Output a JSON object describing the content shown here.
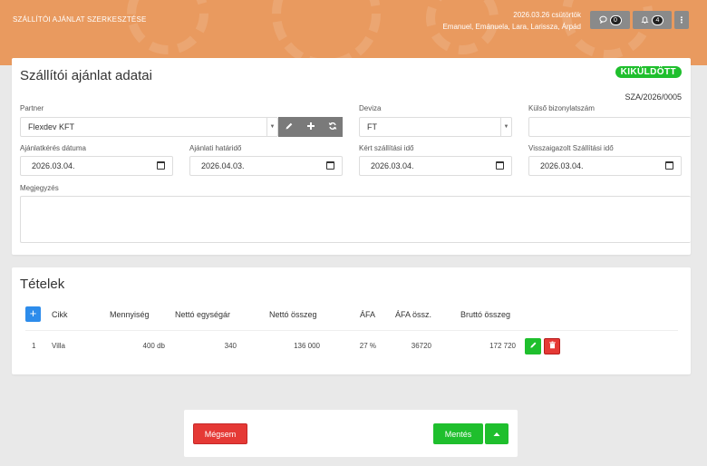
{
  "header": {
    "title": "SZÁLLÍTÓI AJÁNLAT SZERKESZTÉSE",
    "date": "2026.03.26 csütörtök",
    "users": "Emanuel, Emánuela, Lara, Larissza, Árpád",
    "messages_count": "0",
    "notifications_count": "4",
    "menu_glyph": "⋮"
  },
  "offer": {
    "title": "Szállítói ajánlat adatai",
    "status": "KIKÜLDÖTT",
    "status_color": "#1fbf2d",
    "doc_number": "SZA/2026/0005",
    "partner": {
      "label": "Partner",
      "value": "Flexdev KFT"
    },
    "currency": {
      "label": "Deviza",
      "value": "FT"
    },
    "external_doc": {
      "label": "Külső bizonylatszám",
      "value": ""
    },
    "request_date": {
      "label": "Ajánlatkérés dátuma",
      "value": "2026.03.04."
    },
    "deadline": {
      "label": "Ajánlati határidő",
      "value": "2026.04.03."
    },
    "requested_delivery": {
      "label": "Kért szállítási idő",
      "value": "2026.03.04."
    },
    "confirmed_delivery": {
      "label": "Visszaigazolt Szállítási idő",
      "value": "2026.03.04."
    },
    "note": {
      "label": "Megjegyzés",
      "value": ""
    }
  },
  "items": {
    "title": "Tételek",
    "columns": {
      "item": "Cikk",
      "quantity": "Mennyiség",
      "net_unit": "Nettó egységár",
      "net_total": "Nettó összeg",
      "vat": "ÁFA",
      "vat_amount": "ÁFA össz.",
      "gross_total": "Bruttó összeg"
    },
    "rows": [
      {
        "index": "1",
        "item": "Villa",
        "quantity": "400 db",
        "net_unit": "340",
        "net_total": "136 000",
        "vat": "27 %",
        "vat_amount": "36720",
        "gross_total": "172 720"
      }
    ]
  },
  "footer": {
    "cancel_label": "Mégsem",
    "save_label": "Mentés"
  },
  "colors": {
    "header": "#e99a5f",
    "primary_green": "#1fbf2d",
    "danger_red": "#e53935",
    "add_blue": "#2d8ceb",
    "icon_gray": "#7a7a7a"
  },
  "icons": [
    "comment-icon",
    "bell-icon",
    "kebab-menu-icon",
    "pencil-icon",
    "plus-icon",
    "refresh-icon",
    "calendar-icon",
    "trash-icon",
    "chevron-up-icon"
  ]
}
